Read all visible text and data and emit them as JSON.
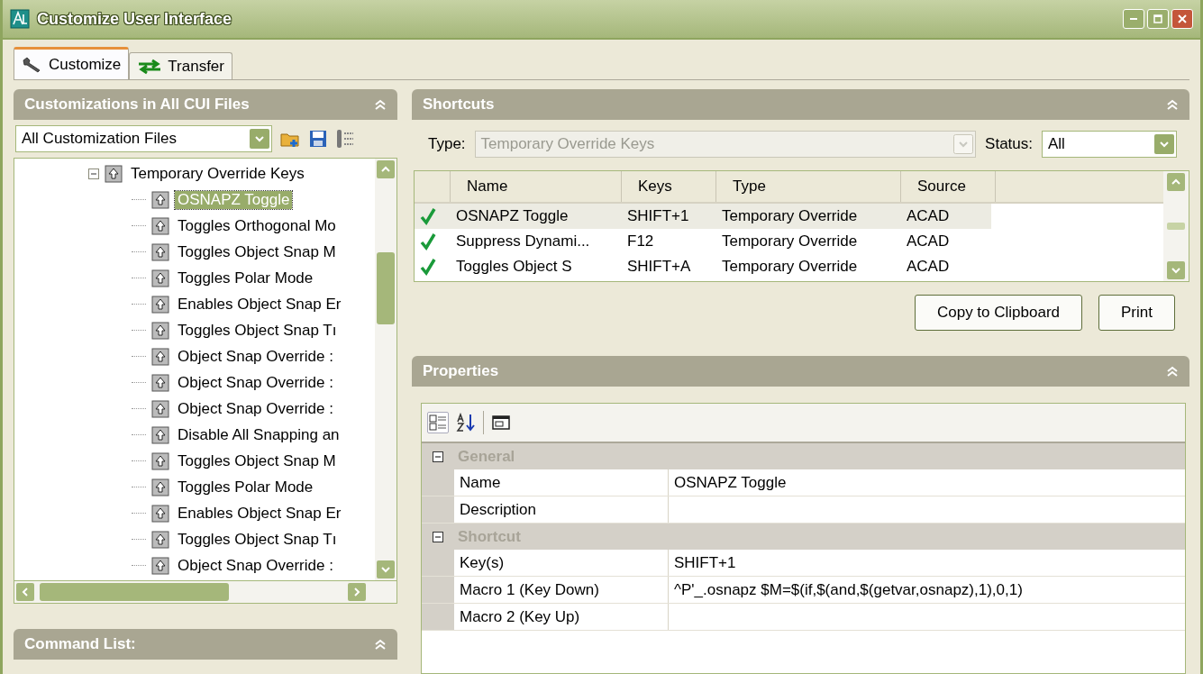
{
  "window": {
    "title": "Customize User Interface"
  },
  "tabs": [
    {
      "label": "Customize",
      "selected": true,
      "kind": "wrench"
    },
    {
      "label": "Transfer",
      "selected": false,
      "kind": "arrows"
    }
  ],
  "customizations_panel": {
    "title": "Customizations in All CUI Files",
    "file_dropdown": {
      "value": "All Customization Files"
    },
    "tree": {
      "label": "Temporary Override Keys",
      "expanded": true,
      "children": [
        {
          "label": "OSNAPZ Toggle",
          "selected": true
        },
        {
          "label": "Toggles Orthogonal Mo",
          "selected": false
        },
        {
          "label": "Toggles Object Snap M",
          "selected": false
        },
        {
          "label": "Toggles Polar Mode",
          "selected": false
        },
        {
          "label": "Enables Object Snap Er",
          "selected": false
        },
        {
          "label": "Toggles Object Snap Tı",
          "selected": false
        },
        {
          "label": "Object Snap Override :",
          "selected": false
        },
        {
          "label": "Object Snap Override :",
          "selected": false
        },
        {
          "label": "Object Snap Override :",
          "selected": false
        },
        {
          "label": "Disable All Snapping an",
          "selected": false
        },
        {
          "label": "Toggles Object Snap M",
          "selected": false
        },
        {
          "label": "Toggles Polar Mode",
          "selected": false
        },
        {
          "label": "Enables Object Snap Er",
          "selected": false
        },
        {
          "label": "Toggles Object Snap Tı",
          "selected": false
        },
        {
          "label": "Object Snap Override :",
          "selected": false
        }
      ]
    }
  },
  "command_list": {
    "title": "Command List:"
  },
  "shortcuts": {
    "title": "Shortcuts",
    "type_filter": {
      "label": "Type:",
      "value": "Temporary Override Keys",
      "disabled": true
    },
    "status_filter": {
      "label": "Status:",
      "value": "All",
      "disabled": false
    },
    "columns": [
      "Name",
      "Keys",
      "Type",
      "Source"
    ],
    "rows": [
      {
        "name": "OSNAPZ Toggle",
        "keys": "SHIFT+1",
        "type": "Temporary Override",
        "source": "ACAD",
        "active": true,
        "selected": true
      },
      {
        "name": "Suppress Dynami...",
        "keys": "F12",
        "type": "Temporary Override",
        "source": "ACAD",
        "active": true,
        "selected": false
      },
      {
        "name": "Toggles Object S",
        "keys": "SHIFT+A",
        "type": "Temporary Override",
        "source": "ACAD",
        "active": true,
        "selected": false
      }
    ],
    "buttons": [
      "Copy to Clipboard",
      "Print"
    ]
  },
  "properties": {
    "title": "Properties",
    "categories": [
      {
        "name": "General",
        "expanded": true,
        "rows": [
          {
            "name": "Name",
            "value": "OSNAPZ Toggle"
          },
          {
            "name": "Description"
          }
        ]
      },
      {
        "name": "Shortcut",
        "expanded": true,
        "rows": [
          {
            "name": "Key(s)",
            "value": "SHIFT+1"
          },
          {
            "name": "Macro 1 (Key Down)",
            "value": "^P'_.osnapz $M=$(if,$(and,$(getvar,osnapz),1),0,1)"
          },
          {
            "name": "Macro 2 (Key Up)"
          }
        ]
      }
    ]
  }
}
